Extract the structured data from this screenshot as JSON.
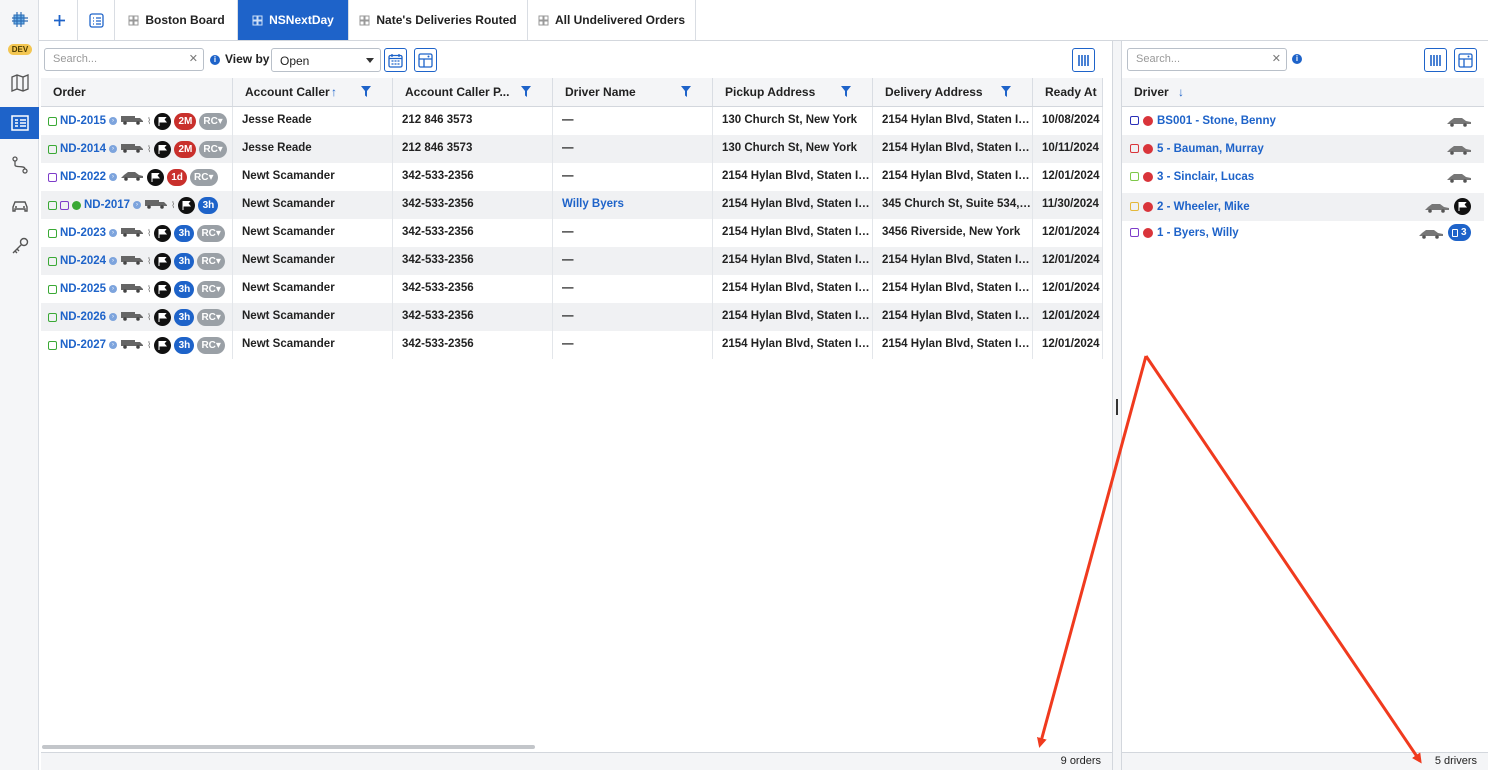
{
  "rail": {
    "dev_badge": "DEV",
    "icons": [
      "logo-icon",
      "map-icon",
      "board-icon",
      "route-icon",
      "car-icon",
      "key-icon"
    ]
  },
  "tabs": [
    {
      "label": "Boston Board",
      "active": false
    },
    {
      "label": "NSNextDay",
      "active": true
    },
    {
      "label": "Nate's Deliveries Routed",
      "active": false
    },
    {
      "label": "All Undelivered Orders",
      "active": false
    }
  ],
  "orders_toolbar": {
    "search_placeholder": "Search...",
    "view_by_label": "View by",
    "view_by_value": "Open"
  },
  "drivers_toolbar": {
    "search_placeholder": "Search..."
  },
  "orders_columns": [
    "Order",
    "Account Caller",
    "Account Caller P...",
    "Driver Name",
    "Pickup Address",
    "Delivery Address",
    "Ready At"
  ],
  "orders": [
    {
      "id": "ND-2015",
      "status_color": "#3aa935",
      "vehicle": "van",
      "route": true,
      "badge": "2M",
      "badge_color": "red",
      "rc": "RC",
      "caller": "Jesse Reade",
      "phone": "212 846 3573",
      "driver": "—",
      "pickup": "130 Church St, New York",
      "delivery": "2154 Hylan Blvd, Staten Isl...",
      "ready": "10/08/2024"
    },
    {
      "id": "ND-2014",
      "status_color": "#3aa935",
      "vehicle": "van",
      "route": true,
      "badge": "2M",
      "badge_color": "red",
      "rc": "RC",
      "caller": "Jesse Reade",
      "phone": "212 846 3573",
      "driver": "—",
      "pickup": "130 Church St, New York",
      "delivery": "2154 Hylan Blvd, Staten Isl...",
      "ready": "10/11/2024"
    },
    {
      "id": "ND-2022",
      "status_color": "#7d3cc9",
      "vehicle": "car",
      "route": false,
      "badge": "1d",
      "badge_color": "red",
      "rc": "RC",
      "caller": "Newt Scamander",
      "phone": "342-533-2356",
      "driver": "—",
      "pickup": "2154 Hylan Blvd, Staten Isl...",
      "delivery": "2154 Hylan Blvd, Staten Isl...",
      "ready": "12/01/2024"
    },
    {
      "id": "ND-2017",
      "status_color": "#3aa935",
      "extra_status": "#7d3cc9",
      "green_dot": true,
      "vehicle": "van",
      "route": true,
      "badge": "3h",
      "badge_color": "blue",
      "rc": "",
      "caller": "Newt Scamander",
      "phone": "342-533-2356",
      "driver": "Willy Byers",
      "pickup": "2154 Hylan Blvd, Staten Isl...",
      "delivery": "345 Church St, Suite 534, ...",
      "ready": "11/30/2024"
    },
    {
      "id": "ND-2023",
      "status_color": "#3aa935",
      "vehicle": "van",
      "route": true,
      "badge": "3h",
      "badge_color": "blue",
      "rc": "RC",
      "caller": "Newt Scamander",
      "phone": "342-533-2356",
      "driver": "—",
      "pickup": "2154 Hylan Blvd, Staten Isl...",
      "delivery": "3456 Riverside, New York",
      "ready": "12/01/2024"
    },
    {
      "id": "ND-2024",
      "status_color": "#3aa935",
      "vehicle": "van",
      "route": true,
      "badge": "3h",
      "badge_color": "blue",
      "rc": "RC",
      "caller": "Newt Scamander",
      "phone": "342-533-2356",
      "driver": "—",
      "pickup": "2154 Hylan Blvd, Staten Isl...",
      "delivery": "2154 Hylan Blvd, Staten Isl...",
      "ready": "12/01/2024"
    },
    {
      "id": "ND-2025",
      "status_color": "#3aa935",
      "vehicle": "van",
      "route": true,
      "badge": "3h",
      "badge_color": "blue",
      "rc": "RC",
      "caller": "Newt Scamander",
      "phone": "342-533-2356",
      "driver": "—",
      "pickup": "2154 Hylan Blvd, Staten Isl...",
      "delivery": "2154 Hylan Blvd, Staten Isl...",
      "ready": "12/01/2024"
    },
    {
      "id": "ND-2026",
      "status_color": "#3aa935",
      "vehicle": "van",
      "route": true,
      "badge": "3h",
      "badge_color": "blue",
      "rc": "RC",
      "caller": "Newt Scamander",
      "phone": "342-533-2356",
      "driver": "—",
      "pickup": "2154 Hylan Blvd, Staten Isl...",
      "delivery": "2154 Hylan Blvd, Staten Isl...",
      "ready": "12/01/2024"
    },
    {
      "id": "ND-2027",
      "status_color": "#3aa935",
      "vehicle": "van",
      "route": true,
      "badge": "3h",
      "badge_color": "blue",
      "rc": "RC",
      "caller": "Newt Scamander",
      "phone": "342-533-2356",
      "driver": "—",
      "pickup": "2154 Hylan Blvd, Staten Isl...",
      "delivery": "2154 Hylan Blvd, Staten Isl...",
      "ready": "12/01/2024"
    }
  ],
  "drivers_column": "Driver",
  "drivers": [
    {
      "name": "BS001 - Stone, Benny",
      "icon_color": "#2a2fb8",
      "dot_color": "#d9343a",
      "flag": false,
      "count": ""
    },
    {
      "name": "5 - Bauman, Murray",
      "icon_color": "#d9343a",
      "dot_color": "#d9343a",
      "flag": false,
      "count": ""
    },
    {
      "name": "3 - Sinclair, Lucas",
      "icon_color": "#7ec84a",
      "dot_color": "#d9343a",
      "flag": false,
      "count": ""
    },
    {
      "name": "2 - Wheeler, Mike",
      "icon_color": "#e4b83a",
      "dot_color": "#d9343a",
      "flag": true,
      "count": ""
    },
    {
      "name": "1 - Byers, Willy",
      "icon_color": "#7d3cc9",
      "dot_color": "#d9343a",
      "flag": false,
      "count": "3"
    }
  ],
  "footer": {
    "orders_count": "9 orders",
    "drivers_count": "5 drivers"
  },
  "colors": {
    "accent": "#1e63c9",
    "annotation_arrow": "#f03a1e"
  }
}
